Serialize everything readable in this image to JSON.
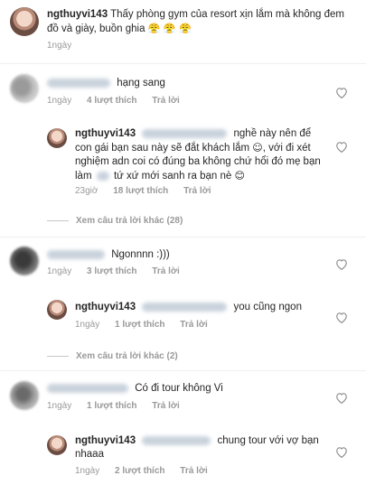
{
  "post": {
    "username": "ngthuyvi143",
    "text": "Thấy phòng gym của resort xịn lắm mà không đem đồ và giày, buồn ghia",
    "emoji": "😤 😤 😤",
    "time": "1ngày"
  },
  "comments": [
    {
      "text": "hạng sang",
      "time": "1ngày",
      "likes": "4 lượt thích",
      "reply": "Trả lời"
    },
    {
      "username": "ngthuyvi143",
      "text_a": "nghề này nên để con gái bạn sau này sẽ đắt khách lắm",
      "emoji_a": "☺",
      "text_b": ", với đi xét nghiệm adn coi có đúng ba không chứ hổi đó mẹ bạn làm",
      "text_c": "tứ xứ mới sanh ra bạn nè",
      "emoji_b": "😊",
      "time": "23giờ",
      "likes": "18 lượt thích",
      "reply": "Trả lời"
    },
    {
      "view_more": "Xem câu trả lời khác (28)"
    },
    {
      "text": "Ngonnnn :)))",
      "time": "1ngày",
      "likes": "3 lượt thích",
      "reply": "Trả lời"
    },
    {
      "username": "ngthuyvi143",
      "text": "you cũng ngon",
      "time": "1ngày",
      "likes": "1 lượt thích",
      "reply": "Trả lời"
    },
    {
      "view_more": "Xem câu trả lời khác (2)"
    },
    {
      "text": "Có đi tour không Vi",
      "time": "1ngày",
      "likes": "1 lượt thích",
      "reply": "Trả lời"
    },
    {
      "username": "ngthuyvi143",
      "text": "chung tour với vợ bạn nhaaa",
      "time": "1ngày",
      "likes": "2 lượt thích",
      "reply": "Trả lời"
    }
  ],
  "icons": {
    "heart": "heart-outline-icon"
  },
  "colors": {
    "meta_text": "#999999",
    "divider": "#efefef"
  }
}
